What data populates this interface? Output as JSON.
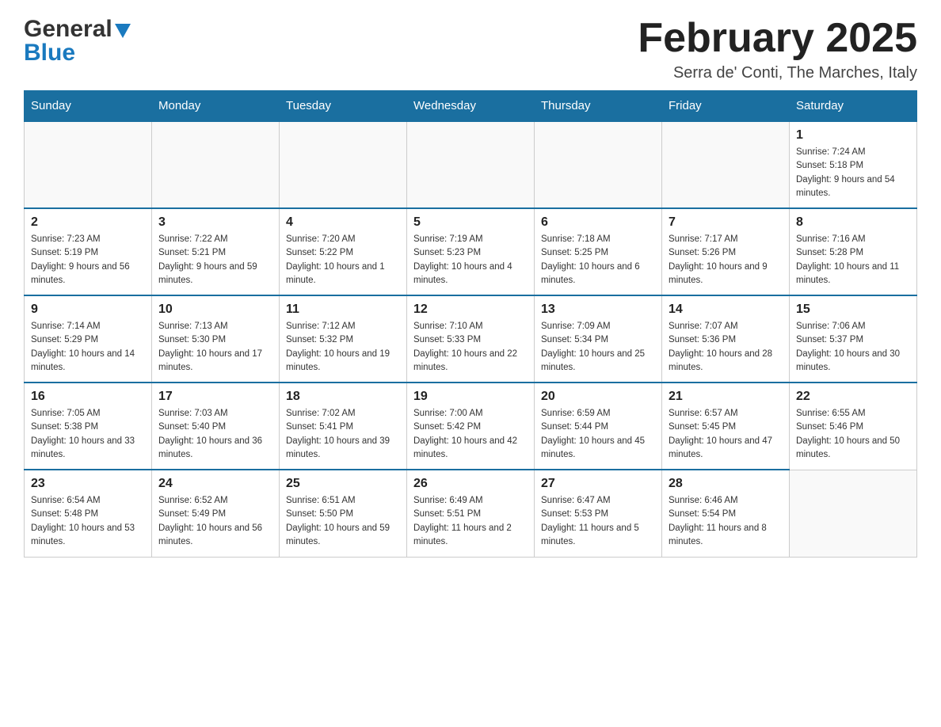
{
  "header": {
    "logo_general": "General",
    "logo_blue": "Blue",
    "month_title": "February 2025",
    "location": "Serra de' Conti, The Marches, Italy"
  },
  "days_of_week": [
    "Sunday",
    "Monday",
    "Tuesday",
    "Wednesday",
    "Thursday",
    "Friday",
    "Saturday"
  ],
  "weeks": [
    [
      {
        "day": "",
        "info": ""
      },
      {
        "day": "",
        "info": ""
      },
      {
        "day": "",
        "info": ""
      },
      {
        "day": "",
        "info": ""
      },
      {
        "day": "",
        "info": ""
      },
      {
        "day": "",
        "info": ""
      },
      {
        "day": "1",
        "info": "Sunrise: 7:24 AM\nSunset: 5:18 PM\nDaylight: 9 hours and 54 minutes."
      }
    ],
    [
      {
        "day": "2",
        "info": "Sunrise: 7:23 AM\nSunset: 5:19 PM\nDaylight: 9 hours and 56 minutes."
      },
      {
        "day": "3",
        "info": "Sunrise: 7:22 AM\nSunset: 5:21 PM\nDaylight: 9 hours and 59 minutes."
      },
      {
        "day": "4",
        "info": "Sunrise: 7:20 AM\nSunset: 5:22 PM\nDaylight: 10 hours and 1 minute."
      },
      {
        "day": "5",
        "info": "Sunrise: 7:19 AM\nSunset: 5:23 PM\nDaylight: 10 hours and 4 minutes."
      },
      {
        "day": "6",
        "info": "Sunrise: 7:18 AM\nSunset: 5:25 PM\nDaylight: 10 hours and 6 minutes."
      },
      {
        "day": "7",
        "info": "Sunrise: 7:17 AM\nSunset: 5:26 PM\nDaylight: 10 hours and 9 minutes."
      },
      {
        "day": "8",
        "info": "Sunrise: 7:16 AM\nSunset: 5:28 PM\nDaylight: 10 hours and 11 minutes."
      }
    ],
    [
      {
        "day": "9",
        "info": "Sunrise: 7:14 AM\nSunset: 5:29 PM\nDaylight: 10 hours and 14 minutes."
      },
      {
        "day": "10",
        "info": "Sunrise: 7:13 AM\nSunset: 5:30 PM\nDaylight: 10 hours and 17 minutes."
      },
      {
        "day": "11",
        "info": "Sunrise: 7:12 AM\nSunset: 5:32 PM\nDaylight: 10 hours and 19 minutes."
      },
      {
        "day": "12",
        "info": "Sunrise: 7:10 AM\nSunset: 5:33 PM\nDaylight: 10 hours and 22 minutes."
      },
      {
        "day": "13",
        "info": "Sunrise: 7:09 AM\nSunset: 5:34 PM\nDaylight: 10 hours and 25 minutes."
      },
      {
        "day": "14",
        "info": "Sunrise: 7:07 AM\nSunset: 5:36 PM\nDaylight: 10 hours and 28 minutes."
      },
      {
        "day": "15",
        "info": "Sunrise: 7:06 AM\nSunset: 5:37 PM\nDaylight: 10 hours and 30 minutes."
      }
    ],
    [
      {
        "day": "16",
        "info": "Sunrise: 7:05 AM\nSunset: 5:38 PM\nDaylight: 10 hours and 33 minutes."
      },
      {
        "day": "17",
        "info": "Sunrise: 7:03 AM\nSunset: 5:40 PM\nDaylight: 10 hours and 36 minutes."
      },
      {
        "day": "18",
        "info": "Sunrise: 7:02 AM\nSunset: 5:41 PM\nDaylight: 10 hours and 39 minutes."
      },
      {
        "day": "19",
        "info": "Sunrise: 7:00 AM\nSunset: 5:42 PM\nDaylight: 10 hours and 42 minutes."
      },
      {
        "day": "20",
        "info": "Sunrise: 6:59 AM\nSunset: 5:44 PM\nDaylight: 10 hours and 45 minutes."
      },
      {
        "day": "21",
        "info": "Sunrise: 6:57 AM\nSunset: 5:45 PM\nDaylight: 10 hours and 47 minutes."
      },
      {
        "day": "22",
        "info": "Sunrise: 6:55 AM\nSunset: 5:46 PM\nDaylight: 10 hours and 50 minutes."
      }
    ],
    [
      {
        "day": "23",
        "info": "Sunrise: 6:54 AM\nSunset: 5:48 PM\nDaylight: 10 hours and 53 minutes."
      },
      {
        "day": "24",
        "info": "Sunrise: 6:52 AM\nSunset: 5:49 PM\nDaylight: 10 hours and 56 minutes."
      },
      {
        "day": "25",
        "info": "Sunrise: 6:51 AM\nSunset: 5:50 PM\nDaylight: 10 hours and 59 minutes."
      },
      {
        "day": "26",
        "info": "Sunrise: 6:49 AM\nSunset: 5:51 PM\nDaylight: 11 hours and 2 minutes."
      },
      {
        "day": "27",
        "info": "Sunrise: 6:47 AM\nSunset: 5:53 PM\nDaylight: 11 hours and 5 minutes."
      },
      {
        "day": "28",
        "info": "Sunrise: 6:46 AM\nSunset: 5:54 PM\nDaylight: 11 hours and 8 minutes."
      },
      {
        "day": "",
        "info": ""
      }
    ]
  ]
}
